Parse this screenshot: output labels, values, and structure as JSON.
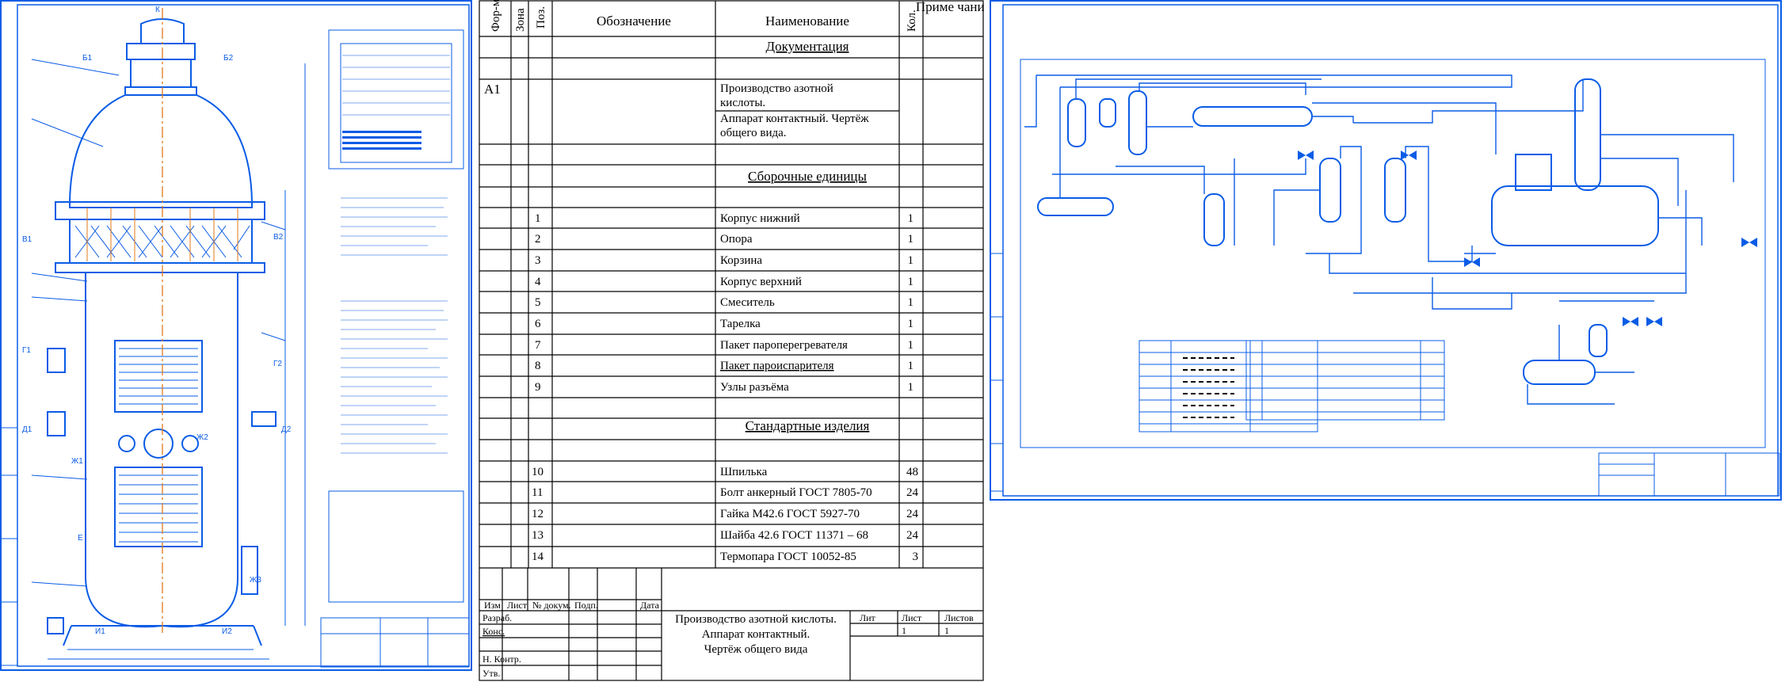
{
  "colors": {
    "drawing_blue": "#0a5ce6",
    "black": "#000000",
    "center_orange": "#e07a1a",
    "paper": "#ffffff"
  },
  "left_sheet": {
    "icon": "apparatus-drawing",
    "labels": [
      "Б1",
      "Б2",
      "В1",
      "В2",
      "Г1",
      "Г2",
      "Д1",
      "Д2",
      "Е",
      "Ж1",
      "Ж2",
      "Ж3",
      "И1",
      "И2",
      "К"
    ]
  },
  "spec": {
    "headers": {
      "format": "Фор-мат",
      "zone": "Зона",
      "pos": "Поз.",
      "designation": "Обозначение",
      "name": "Наименование",
      "qty": "Кол.",
      "note": "Приме чание"
    },
    "sections": {
      "documentation": "Документация",
      "assembly": "Сборочные единицы",
      "standard": "Стандартные изделия"
    },
    "doc_format": "А1",
    "doc_lines": [
      "Производство азотной",
      "кислоты.",
      "Аппарат контактный. Чертёж",
      "общего вида."
    ],
    "assembly_items": [
      {
        "pos": "1",
        "name": "Корпус нижний",
        "qty": "1"
      },
      {
        "pos": "2",
        "name": "Опора",
        "qty": "1"
      },
      {
        "pos": "3",
        "name": "Корзина",
        "qty": "1"
      },
      {
        "pos": "4",
        "name": "Корпус верхний",
        "qty": "1"
      },
      {
        "pos": "5",
        "name": "Смеситель",
        "qty": "1"
      },
      {
        "pos": "6",
        "name": "Тарелка",
        "qty": "1"
      },
      {
        "pos": "7",
        "name": "Пакет пароперегревателя",
        "qty": "1"
      },
      {
        "pos": "8",
        "name": "Пакет пароиспарителя",
        "qty": "1"
      },
      {
        "pos": "9",
        "name": "Узлы разъёма",
        "qty": "1"
      }
    ],
    "standard_items": [
      {
        "pos": "10",
        "name": "Шпилька",
        "qty": "48"
      },
      {
        "pos": "11",
        "name": "Болт анкерный ГОСТ 7805-70",
        "qty": "24"
      },
      {
        "pos": "12",
        "name": "Гайка М42.6 ГОСТ 5927-70",
        "qty": "24"
      },
      {
        "pos": "13",
        "name": "Шайба 42.6 ГОСТ 11371 – 68",
        "qty": "24"
      },
      {
        "pos": "14",
        "name": "Термопара ГОСТ 10052-85",
        "qty": "3"
      }
    ],
    "stamp": {
      "col_headers": [
        "Изм",
        "Лист",
        "№ докум.",
        "Подп.",
        "Дата"
      ],
      "roles": [
        "Разраб.",
        "Конс.",
        "Н. Контр.",
        "Утв."
      ],
      "title_lines": [
        "Производство азотной кислоты.",
        "Аппарат контактный.",
        "Чертёж общего вида"
      ],
      "lit_label": "Лит",
      "sheet_label": "Лист",
      "sheets_label": "Листов",
      "sheet_value": "1",
      "sheets_value": "1"
    }
  },
  "right_sheet": {
    "icon": "process-flow-diagram"
  }
}
